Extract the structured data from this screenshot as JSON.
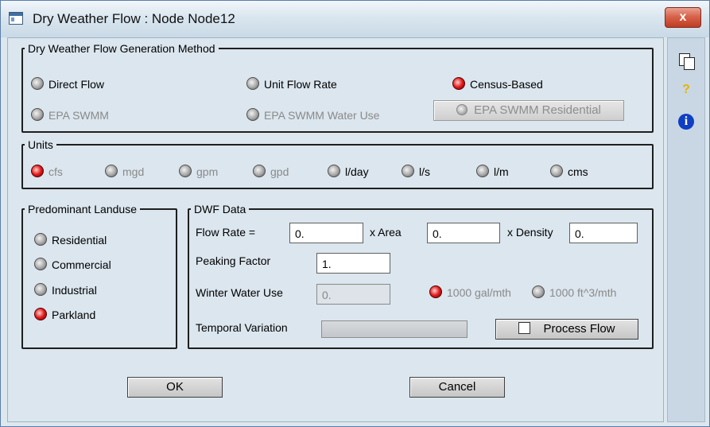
{
  "window": {
    "title": "Dry Weather Flow : Node Node12",
    "close_label": "x"
  },
  "method": {
    "legend": "Dry Weather Flow Generation Method",
    "options": [
      {
        "label": "Direct Flow",
        "selected": false,
        "enabled": true
      },
      {
        "label": "Unit Flow Rate",
        "selected": false,
        "enabled": true
      },
      {
        "label": "Census-Based",
        "selected": true,
        "enabled": true
      },
      {
        "label": "EPA SWMM",
        "selected": false,
        "enabled": false
      },
      {
        "label": "EPA SWMM Water Use",
        "selected": false,
        "enabled": false
      }
    ],
    "residential_button": "EPA SWMM Residential"
  },
  "units": {
    "legend": "Units",
    "options": [
      {
        "label": "cfs",
        "selected": true,
        "enabled": false
      },
      {
        "label": "mgd",
        "selected": false,
        "enabled": false
      },
      {
        "label": "gpm",
        "selected": false,
        "enabled": false
      },
      {
        "label": "gpd",
        "selected": false,
        "enabled": false
      },
      {
        "label": "l/day",
        "selected": false,
        "enabled": true
      },
      {
        "label": "l/s",
        "selected": false,
        "enabled": true
      },
      {
        "label": "l/m",
        "selected": false,
        "enabled": true
      },
      {
        "label": "cms",
        "selected": false,
        "enabled": true
      }
    ]
  },
  "landuse": {
    "legend": "Predominant Landuse",
    "options": [
      {
        "label": "Residential",
        "selected": false
      },
      {
        "label": "Commercial",
        "selected": false
      },
      {
        "label": "Industrial",
        "selected": false
      },
      {
        "label": "Parkland",
        "selected": true
      }
    ]
  },
  "dwf": {
    "legend": "DWF Data",
    "flow_rate_label": "Flow Rate =",
    "flow_rate_value": "0.",
    "area_label": "x Area",
    "area_value": "0.",
    "density_label": "x Density",
    "density_value": "0.",
    "peaking_label": "Peaking Factor",
    "peaking_value": "1.",
    "winter_label": "Winter Water Use",
    "winter_value": "0.",
    "unit_gal": "1000 gal/mth",
    "unit_ft": "1000 ft^3/mth",
    "temporal_label": "Temporal Variation",
    "process_label": "Process Flow"
  },
  "buttons": {
    "ok": "OK",
    "cancel": "Cancel"
  },
  "toolbar": {
    "help_glyph": "?",
    "info_glyph": "i"
  },
  "colors": {
    "accent": "#e21b1b",
    "title_bg": "#dae6ef",
    "close_bg": "#d8634b"
  }
}
